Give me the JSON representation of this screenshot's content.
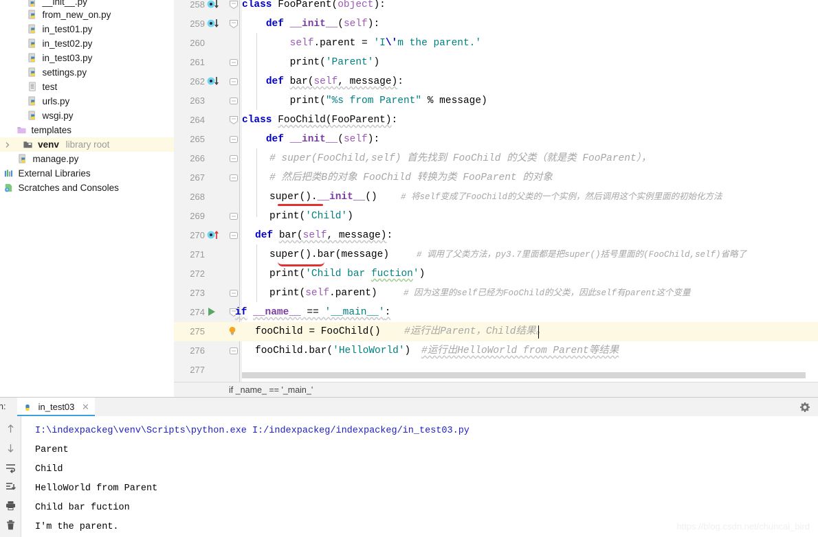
{
  "sidebar": {
    "items": [
      {
        "label": "__init__.py",
        "icon": "python-file-icon",
        "indent": 36,
        "clipped": true
      },
      {
        "label": "from_new_on.py",
        "icon": "python-file-icon",
        "indent": 36
      },
      {
        "label": "in_test01.py",
        "icon": "python-file-icon",
        "indent": 36
      },
      {
        "label": "in_test02.py",
        "icon": "python-file-icon",
        "indent": 36
      },
      {
        "label": "in_test03.py",
        "icon": "python-file-icon",
        "indent": 36
      },
      {
        "label": "settings.py",
        "icon": "python-file-icon",
        "indent": 36
      },
      {
        "label": "test",
        "icon": "text-file-icon",
        "indent": 36
      },
      {
        "label": "urls.py",
        "icon": "python-file-icon",
        "indent": 36
      },
      {
        "label": "wsgi.py",
        "icon": "python-file-icon",
        "indent": 36
      },
      {
        "label": "templates",
        "icon": "folder-icon",
        "indent": 20
      },
      {
        "label": "venv",
        "icon": "folder-dark-icon",
        "indent": 20,
        "badge": "library root",
        "selected": true,
        "arrow": true
      },
      {
        "label": "manage.py",
        "icon": "python-file-icon",
        "indent": 36
      },
      {
        "label": "External Libraries",
        "icon": "libraries-icon",
        "indent": 4
      },
      {
        "label": "Scratches and Consoles",
        "icon": "scratches-icon",
        "indent": 4
      }
    ]
  },
  "editor": {
    "breadcrumb": "if _name_ == '_main_'",
    "lines": [
      {
        "num": "258",
        "gutter": "implemented-marker-down",
        "fold": "fold-open-top"
      },
      {
        "num": "259",
        "gutter": "implemented-marker-down",
        "fold": "fold-open-top"
      },
      {
        "num": "260",
        "gutter": "",
        "fold": ""
      },
      {
        "num": "261",
        "gutter": "",
        "fold": "fold-collapse"
      },
      {
        "num": "262",
        "gutter": "implemented-marker-down",
        "fold": "fold-collapse"
      },
      {
        "num": "263",
        "gutter": "",
        "fold": "fold-collapse"
      },
      {
        "num": "264",
        "gutter": "",
        "fold": "fold-open-top"
      },
      {
        "num": "265",
        "gutter": "",
        "fold": "fold-collapse"
      },
      {
        "num": "266",
        "gutter": "",
        "fold": "fold-collapse"
      },
      {
        "num": "267",
        "gutter": "",
        "fold": "fold-collapse"
      },
      {
        "num": "268",
        "gutter": "",
        "fold": ""
      },
      {
        "num": "269",
        "gutter": "",
        "fold": "fold-collapse"
      },
      {
        "num": "270",
        "gutter": "overrides-marker-up",
        "fold": "fold-collapse"
      },
      {
        "num": "271",
        "gutter": "",
        "fold": ""
      },
      {
        "num": "272",
        "gutter": "",
        "fold": ""
      },
      {
        "num": "273",
        "gutter": "",
        "fold": "fold-collapse"
      },
      {
        "num": "274",
        "gutter": "run-arrow",
        "fold": "fold-open-top"
      },
      {
        "num": "275",
        "gutter": "intention-bulb",
        "fold": "",
        "highlight": true
      },
      {
        "num": "276",
        "gutter": "",
        "fold": "fold-collapse"
      },
      {
        "num": "277",
        "gutter": "",
        "fold": ""
      }
    ],
    "code": {
      "l258": "class FooParent(object):",
      "l259": "def __init__(self):",
      "l260": "self.parent = 'I\\'m the parent.'",
      "l261": "print('Parent')",
      "l262": "def bar(self, message):",
      "l263": "print(\"%s from Parent\" % message)",
      "l264": "class FooChild(FooParent):",
      "l265": "def __init__(self):",
      "l266": "# super(FooChild,self) 首先找到 FooChild 的父类（就是类 FooParent），",
      "l267": "# 然后把类B的对象 FooChild 转换为类 FooParent 的对象",
      "l268": "super().__init__()",
      "l268c": "# 将self变成了FooChild的父类的一个实例，然后调用这个实例里面的初始化方法",
      "l269": "print('Child')",
      "l270": "def bar(self, message):",
      "l271": "super().bar(message)",
      "l271c": "# 调用了父类方法，py3.7里面都是把super()括号里面的(FooChild,self)省略了",
      "l272": "print('Child bar fuction')",
      "l273": "print(self.parent)",
      "l273c": "# 因为这里的self已经为FooChild的父类，因此self有parent这个变量",
      "l274": "if __name__ == '__main__':",
      "l275": "fooChild = FooChild()",
      "l275c": "#运行出Parent，Child结果。",
      "l276": "fooChild.bar('HelloWorld')",
      "l276c": "#运行出HelloWorld from Parent等结果"
    }
  },
  "console": {
    "run_label": "n:",
    "tab_name": "in_test03",
    "tab_close": "✕",
    "toolbar_icons": [
      "up-arrow-icon",
      "down-arrow-icon",
      "soft-wrap-icon",
      "scroll-to-end-icon",
      "print-icon",
      "trash-icon"
    ],
    "gear_icon": "gear-icon",
    "output": [
      {
        "text": "I:\\indexpackeg\\venv\\Scripts\\python.exe I:/indexpackeg/indexpackeg/in_test03.py",
        "kind": "cmd"
      },
      {
        "text": "Parent",
        "kind": "out"
      },
      {
        "text": "Child",
        "kind": "out"
      },
      {
        "text": "HelloWorld from Parent",
        "kind": "out"
      },
      {
        "text": "Child bar fuction",
        "kind": "out"
      },
      {
        "text": "I'm the parent.",
        "kind": "out"
      }
    ]
  },
  "watermark": "https://blog.csdn.net/chuncai_bird",
  "colors": {
    "keyword": "#0000c0",
    "string": "#008080",
    "comment": "#a6a6a6",
    "selection": "#fdf9e3",
    "accent": "#3f9cdb",
    "error_underline": "#e03131"
  }
}
